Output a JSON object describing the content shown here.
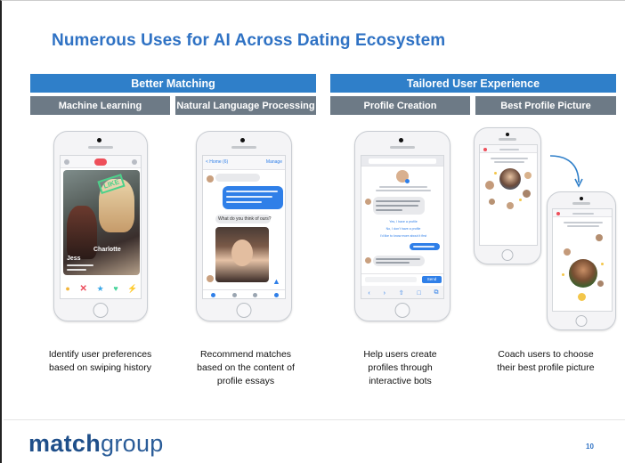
{
  "slide": {
    "title": "Numerous Uses for AI Across Dating Ecosystem",
    "page_number": "10"
  },
  "sections": {
    "left": "Better Matching",
    "right": "Tailored User Experience"
  },
  "columns": [
    {
      "heading": "Machine Learning",
      "caption_lines": [
        "Identify user preferences",
        "based on swiping history"
      ]
    },
    {
      "heading": "Natural Language Processing",
      "caption_lines": [
        "Recommend matches",
        "based on the content of",
        "profile essays"
      ]
    },
    {
      "heading": "Profile Creation",
      "caption_lines": [
        "Help users create",
        "profiles through",
        "interactive bots"
      ]
    },
    {
      "heading": "Best Profile Picture",
      "caption_lines": [
        "Coach users to choose",
        "their best profile picture"
      ]
    }
  ],
  "phone_screens": {
    "tinder": {
      "stamp": "LIKE",
      "name": "Jess",
      "name2": "Charlotte"
    },
    "messenger": {
      "back": "< Home (6)",
      "manage": "Manage",
      "question": "What do you think of ours?"
    },
    "bot_reply_1": "Yes, I have a profile",
    "bot_reply_2": "No, I don't have a profile",
    "bot_reply_3": "I'd like to know more about it first",
    "send_button": "Send"
  },
  "logo": {
    "bold": "match",
    "light": "group"
  },
  "colors": {
    "accent": "#2f7fc9",
    "subheader": "#6d7a86",
    "title": "#2f72c4",
    "logo": "#1f4f8a"
  }
}
